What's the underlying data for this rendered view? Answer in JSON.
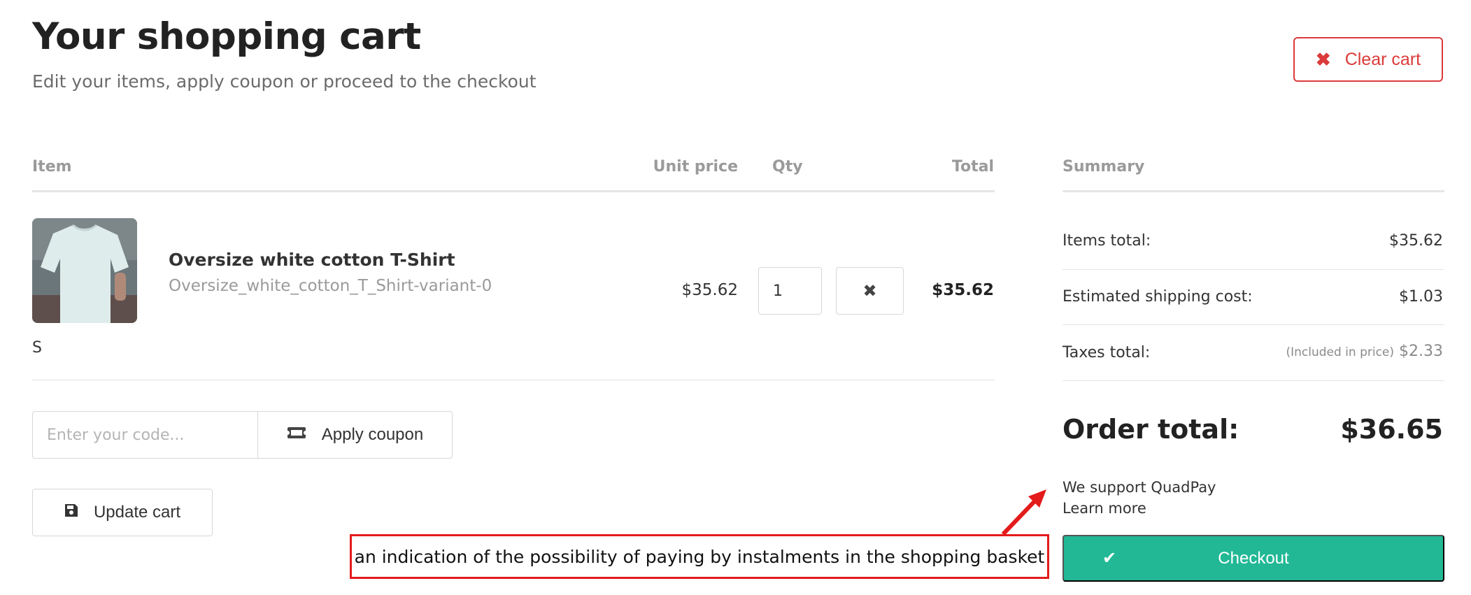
{
  "header": {
    "title": "Your shopping cart",
    "subtitle": "Edit your items, apply coupon or proceed to the checkout",
    "clear_cart_label": "Clear cart"
  },
  "table": {
    "columns": [
      "Item",
      "Unit price",
      "Qty",
      "Total"
    ],
    "rows": [
      {
        "name": "Oversize white cotton T-Shirt",
        "variant": "Oversize_white_cotton_T_Shirt-variant-0",
        "size": "S",
        "unit_price": "$35.62",
        "qty": "1",
        "total": "$35.62"
      }
    ]
  },
  "coupon": {
    "placeholder": "Enter your code...",
    "apply_label": "Apply coupon"
  },
  "update_label": "Update cart",
  "summary": {
    "title": "Summary",
    "items_total_label": "Items total:",
    "items_total_value": "$35.62",
    "shipping_label": "Estimated shipping cost:",
    "shipping_value": "$1.03",
    "taxes_label": "Taxes total:",
    "taxes_note": "(Included in price)",
    "taxes_value": "$2.33",
    "order_total_label": "Order total:",
    "order_total_value": "$36.65",
    "quadpay_text": "We support QuadPay",
    "learn_more": "Learn more",
    "checkout_label": "Checkout"
  },
  "annotation": {
    "text": "an indication of the possibility of paying by instalments in the shopping basket"
  },
  "colors": {
    "accent_red": "#db3b3b",
    "checkout_green": "#22b895",
    "annotation_red": "#e31b1b"
  },
  "icons": {
    "clear": "close-icon",
    "remove": "close-icon",
    "coupon": "ticket-icon",
    "update": "save-icon",
    "checkout": "checkmark-icon"
  }
}
